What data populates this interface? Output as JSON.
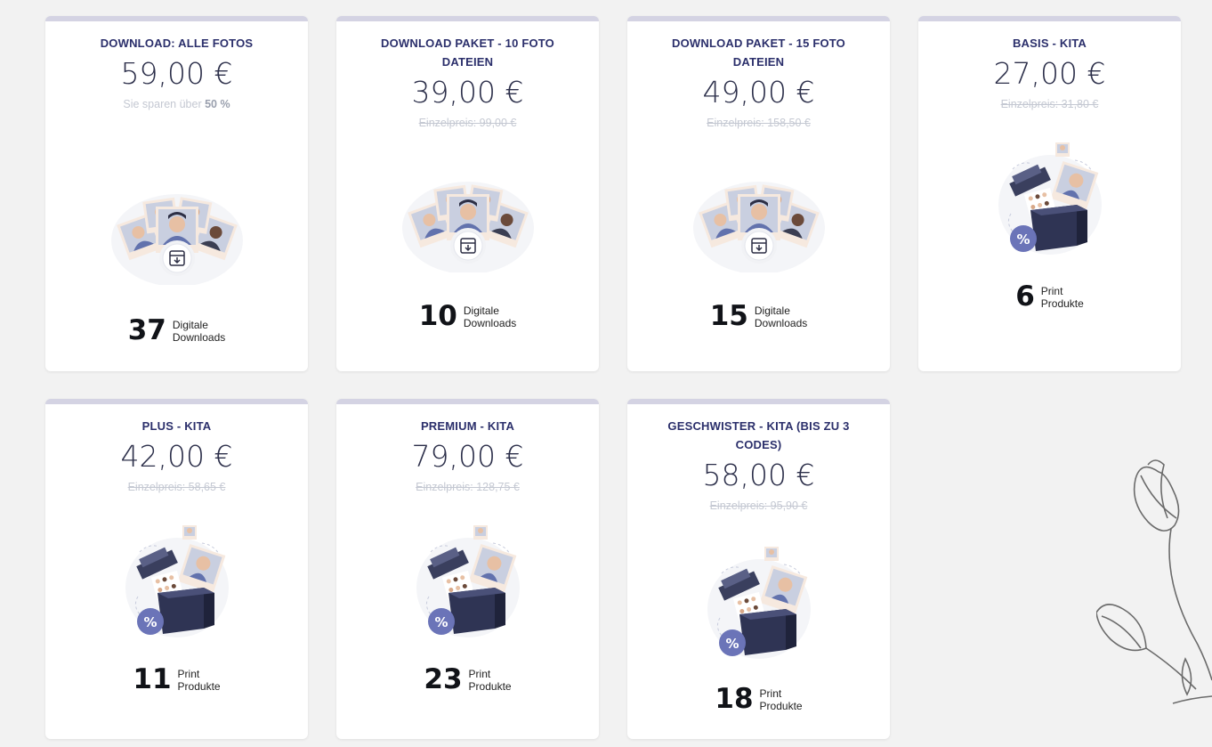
{
  "cards": [
    {
      "title": "DOWNLOAD: ALLE FOTOS",
      "price": "59,00 €",
      "note_prefix": "Sie sparen über ",
      "note_bold": "50 %",
      "count": "37",
      "count_line1": "Digitale",
      "count_line2": "Downloads",
      "icon": "photos-download-icon"
    },
    {
      "title": "DOWNLOAD PAKET - 10 FOTO DATEIEN",
      "price": "39,00 €",
      "note": "Einzelpreis: 99,00 €",
      "count": "10",
      "count_line1": "Digitale",
      "count_line2": "Downloads",
      "icon": "photos-download-icon"
    },
    {
      "title": "DOWNLOAD PAKET - 15 FOTO DATEIEN",
      "price": "49,00 €",
      "note": "Einzelpreis: 158,50 €",
      "count": "15",
      "count_line1": "Digitale",
      "count_line2": "Downloads",
      "icon": "photos-download-icon"
    },
    {
      "title": "BASIS - KITA",
      "price": "27,00 €",
      "note": "Einzelpreis: 31,80 €",
      "count": "6",
      "count_line1": "Print",
      "count_line2": "Produkte",
      "icon": "gift-box-photos-icon"
    },
    {
      "title": "PLUS - KITA",
      "price": "42,00 €",
      "note": "Einzelpreis: 58,65 €",
      "count": "11",
      "count_line1": "Print",
      "count_line2": "Produkte",
      "icon": "gift-box-photos-icon"
    },
    {
      "title": "PREMIUM - KITA",
      "price": "79,00 €",
      "note": "Einzelpreis: 128,75 €",
      "count": "23",
      "count_line1": "Print",
      "count_line2": "Produkte",
      "icon": "gift-box-photos-icon"
    },
    {
      "title": "GESCHWISTER - KITA (BIS ZU 3 CODES)",
      "price": "58,00 €",
      "note": "Einzelpreis: 95,90 €",
      "count": "18",
      "count_line1": "Print",
      "count_line2": "Produkte",
      "icon": "gift-box-photos-icon"
    }
  ],
  "colors": {
    "title": "#2b2f6b",
    "price": "#2c2f4a",
    "accent_badge": "#6b74b8",
    "box": "#2f3454",
    "card_top": "#d4d3e3"
  }
}
